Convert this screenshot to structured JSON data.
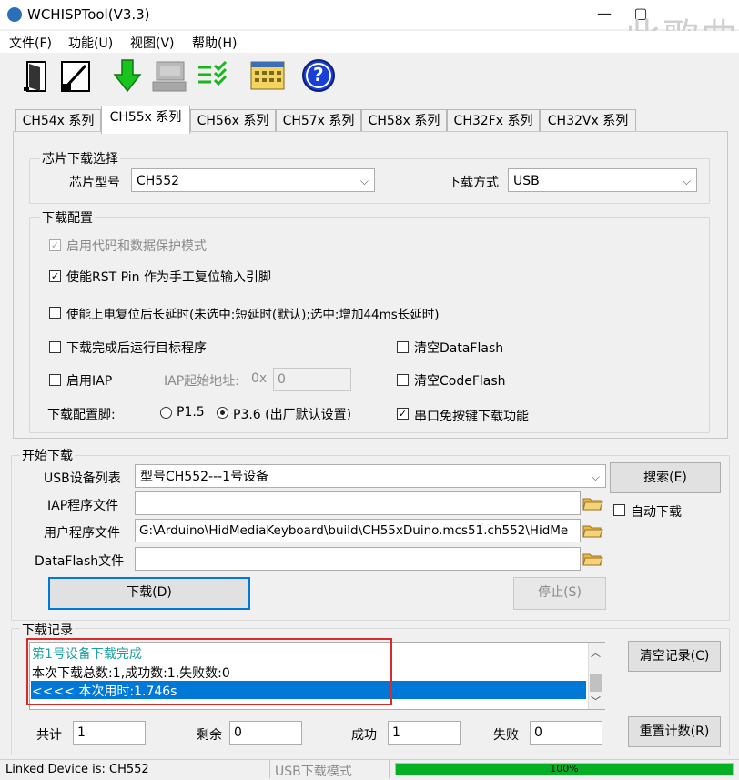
{
  "window": {
    "title": "WCHISPTool(V3.3)",
    "minimize": "—",
    "restore": "▢",
    "watermark": "此歌曲"
  },
  "menu": [
    {
      "label": "文件(F)"
    },
    {
      "label": "功能(U)"
    },
    {
      "label": "视图(V)"
    },
    {
      "label": "帮助(H)"
    }
  ],
  "toolbar": {
    "icons": [
      "open-door-icon",
      "edit-icon",
      "download-arrow-icon",
      "computer-icon",
      "checklist-icon",
      "calendar-icon",
      "help-icon"
    ],
    "help_glyph": "?"
  },
  "tabs": [
    {
      "label": "CH54x 系列"
    },
    {
      "label": "CH55x 系列",
      "active": true
    },
    {
      "label": "CH56x 系列"
    },
    {
      "label": "CH57x 系列"
    },
    {
      "label": "CH58x 系列"
    },
    {
      "label": "CH32Fx 系列"
    },
    {
      "label": "CH32Vx 系列"
    }
  ],
  "chip_select": {
    "group_title": "芯片下载选择",
    "chip_label": "芯片型号",
    "chip_value": "CH552",
    "method_label": "下载方式",
    "method_value": "USB"
  },
  "download_config": {
    "group_title": "下载配置",
    "protect_mode": "启用代码和数据保护模式",
    "rst_pin": "使能RST Pin 作为手工复位输入引脚",
    "long_delay": "使能上电复位后长延时(未选中:短延时(默认);选中:增加44ms长延时)",
    "run_target": "下载完成后运行目标程序",
    "clear_dataflash": "清空DataFlash",
    "enable_iap": "启用IAP",
    "iap_addr_label": "IAP起始地址:",
    "iap_prefix": "0x",
    "iap_addr_value": "0",
    "clear_codeflash": "清空CodeFlash",
    "pin_label": "下载配置脚:",
    "p15": "P1.5",
    "p36": "P3.6 (出厂默认设置)",
    "serial_no_key": "串口免按键下载功能"
  },
  "start_download": {
    "group_title": "开始下载",
    "usb_list_label": "USB设备列表",
    "usb_list_value": "型号CH552---1号设备",
    "search_button": "搜索(E)",
    "iap_file_label": "IAP程序文件",
    "iap_file_value": "",
    "auto_download": "自动下载",
    "user_file_label": "用户程序文件",
    "user_file_value": "G:\\Arduino\\HidMediaKeyboard\\build\\CH55xDuino.mcs51.ch552\\HidMe",
    "dataflash_label": "DataFlash文件",
    "dataflash_value": "",
    "download_button": "下载(D)",
    "stop_button": "停止(S)"
  },
  "log": {
    "group_title": "下载记录",
    "lines": [
      "第1号设备下载完成",
      "本次下载总数:1,成功数:1,失败数:0",
      "<<<< 本次用时:1.746s"
    ],
    "clear_button": "清空记录(C)"
  },
  "counters": {
    "total_label": "共计",
    "total_value": "1",
    "remain_label": "剩余",
    "remain_value": "0",
    "success_label": "成功",
    "success_value": "1",
    "fail_label": "失败",
    "fail_value": "0",
    "reset_button": "重置计数(R)"
  },
  "status": {
    "linked": "Linked Device is: CH552",
    "mode": "USB下载模式",
    "progress_text": "100%",
    "progress": 1.0
  },
  "colors": {
    "log_success": "#20a0a0",
    "selection": "#0078d7",
    "highlight_box": "#d92b2b",
    "progress": "#06b025",
    "help_blue": "#1a3fd6"
  }
}
